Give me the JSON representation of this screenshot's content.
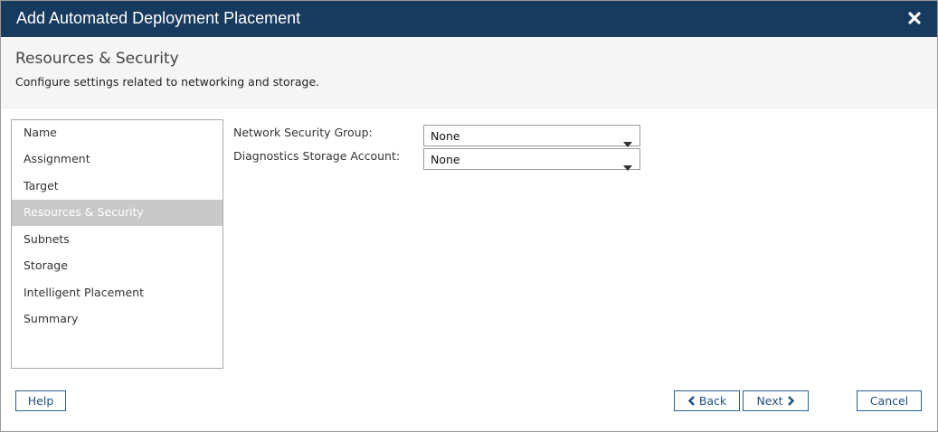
{
  "dialog": {
    "title": "Add Automated Deployment Placement",
    "close_icon": "close-icon",
    "header_color": "#173a5f"
  },
  "header": {
    "title": "Resources & Security",
    "subtitle": "Configure settings related to networking and storage."
  },
  "nav": {
    "items": [
      {
        "label": "Name"
      },
      {
        "label": "Assignment"
      },
      {
        "label": "Target"
      },
      {
        "label": "Resources & Security",
        "active": true
      },
      {
        "label": "Subnets"
      },
      {
        "label": "Storage"
      },
      {
        "label": "Intelligent Placement"
      },
      {
        "label": "Summary"
      }
    ]
  },
  "form": {
    "network_security_group": {
      "label": "Network Security Group:",
      "value": "None"
    },
    "diagnostics_storage_account": {
      "label": "Diagnostics Storage Account:",
      "value": "None"
    }
  },
  "buttons": {
    "help": "Help",
    "back": "Back",
    "next": "Next",
    "cancel": "Cancel"
  }
}
